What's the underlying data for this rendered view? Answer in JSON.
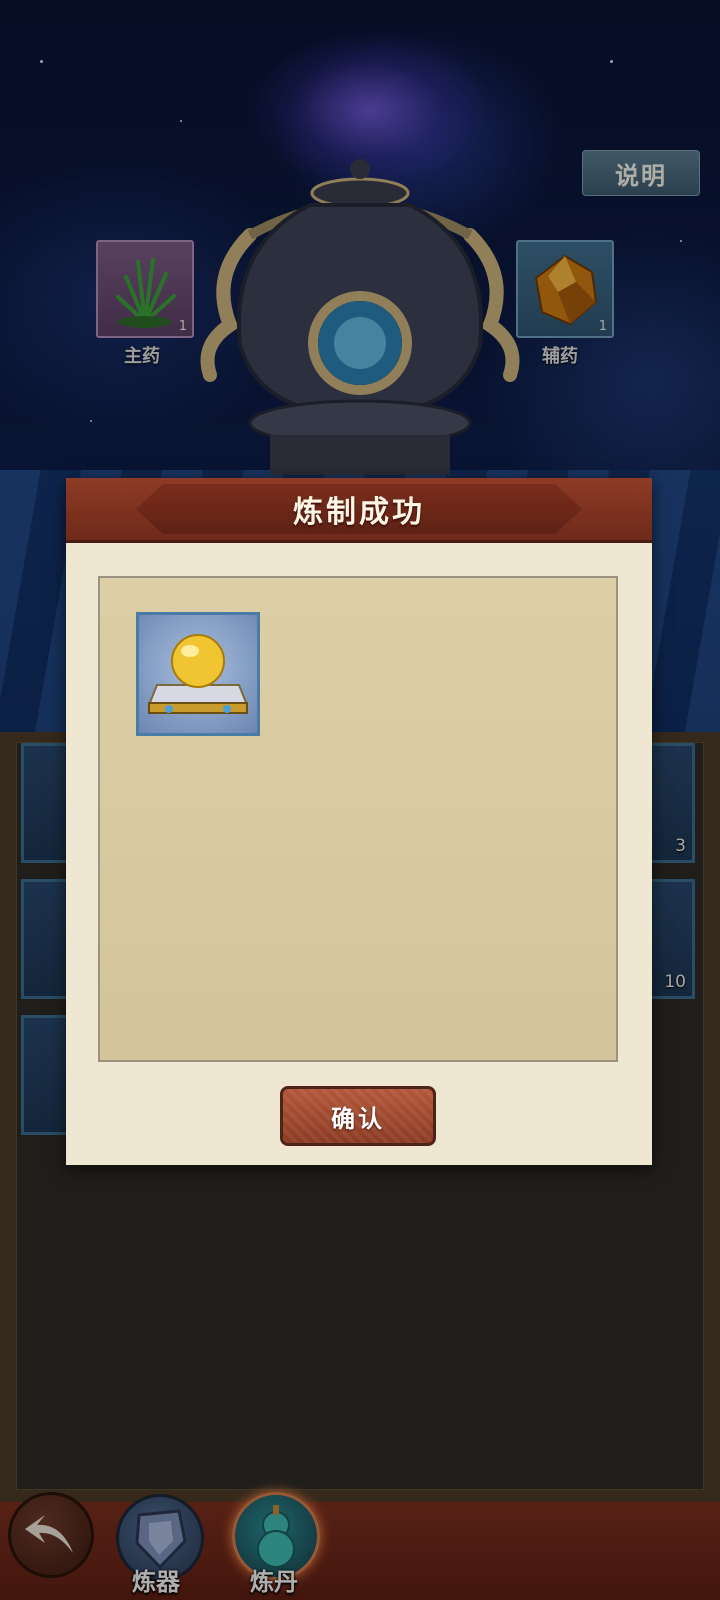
{
  "top": {
    "explain_button": "说明",
    "main_slot": {
      "label": "主药",
      "count": "1"
    },
    "aux_slot": {
      "label": "辅药",
      "count": "1"
    }
  },
  "inventory": {
    "right_counts": [
      "3",
      "10"
    ]
  },
  "modal": {
    "title": "炼制成功",
    "confirm_label": "确认",
    "reward_item_icon": "golden-orb-on-pedestal-icon"
  },
  "bottom_nav": {
    "items": [
      {
        "label": "炼器",
        "icon": "armor-crafting-icon"
      },
      {
        "label": "炼丹",
        "icon": "gourd-alchemy-icon"
      }
    ]
  },
  "colors": {
    "modal_header": "#8e3b26",
    "modal_body": "#efe7d2",
    "slot_border_blue": "#3b6b8f"
  }
}
